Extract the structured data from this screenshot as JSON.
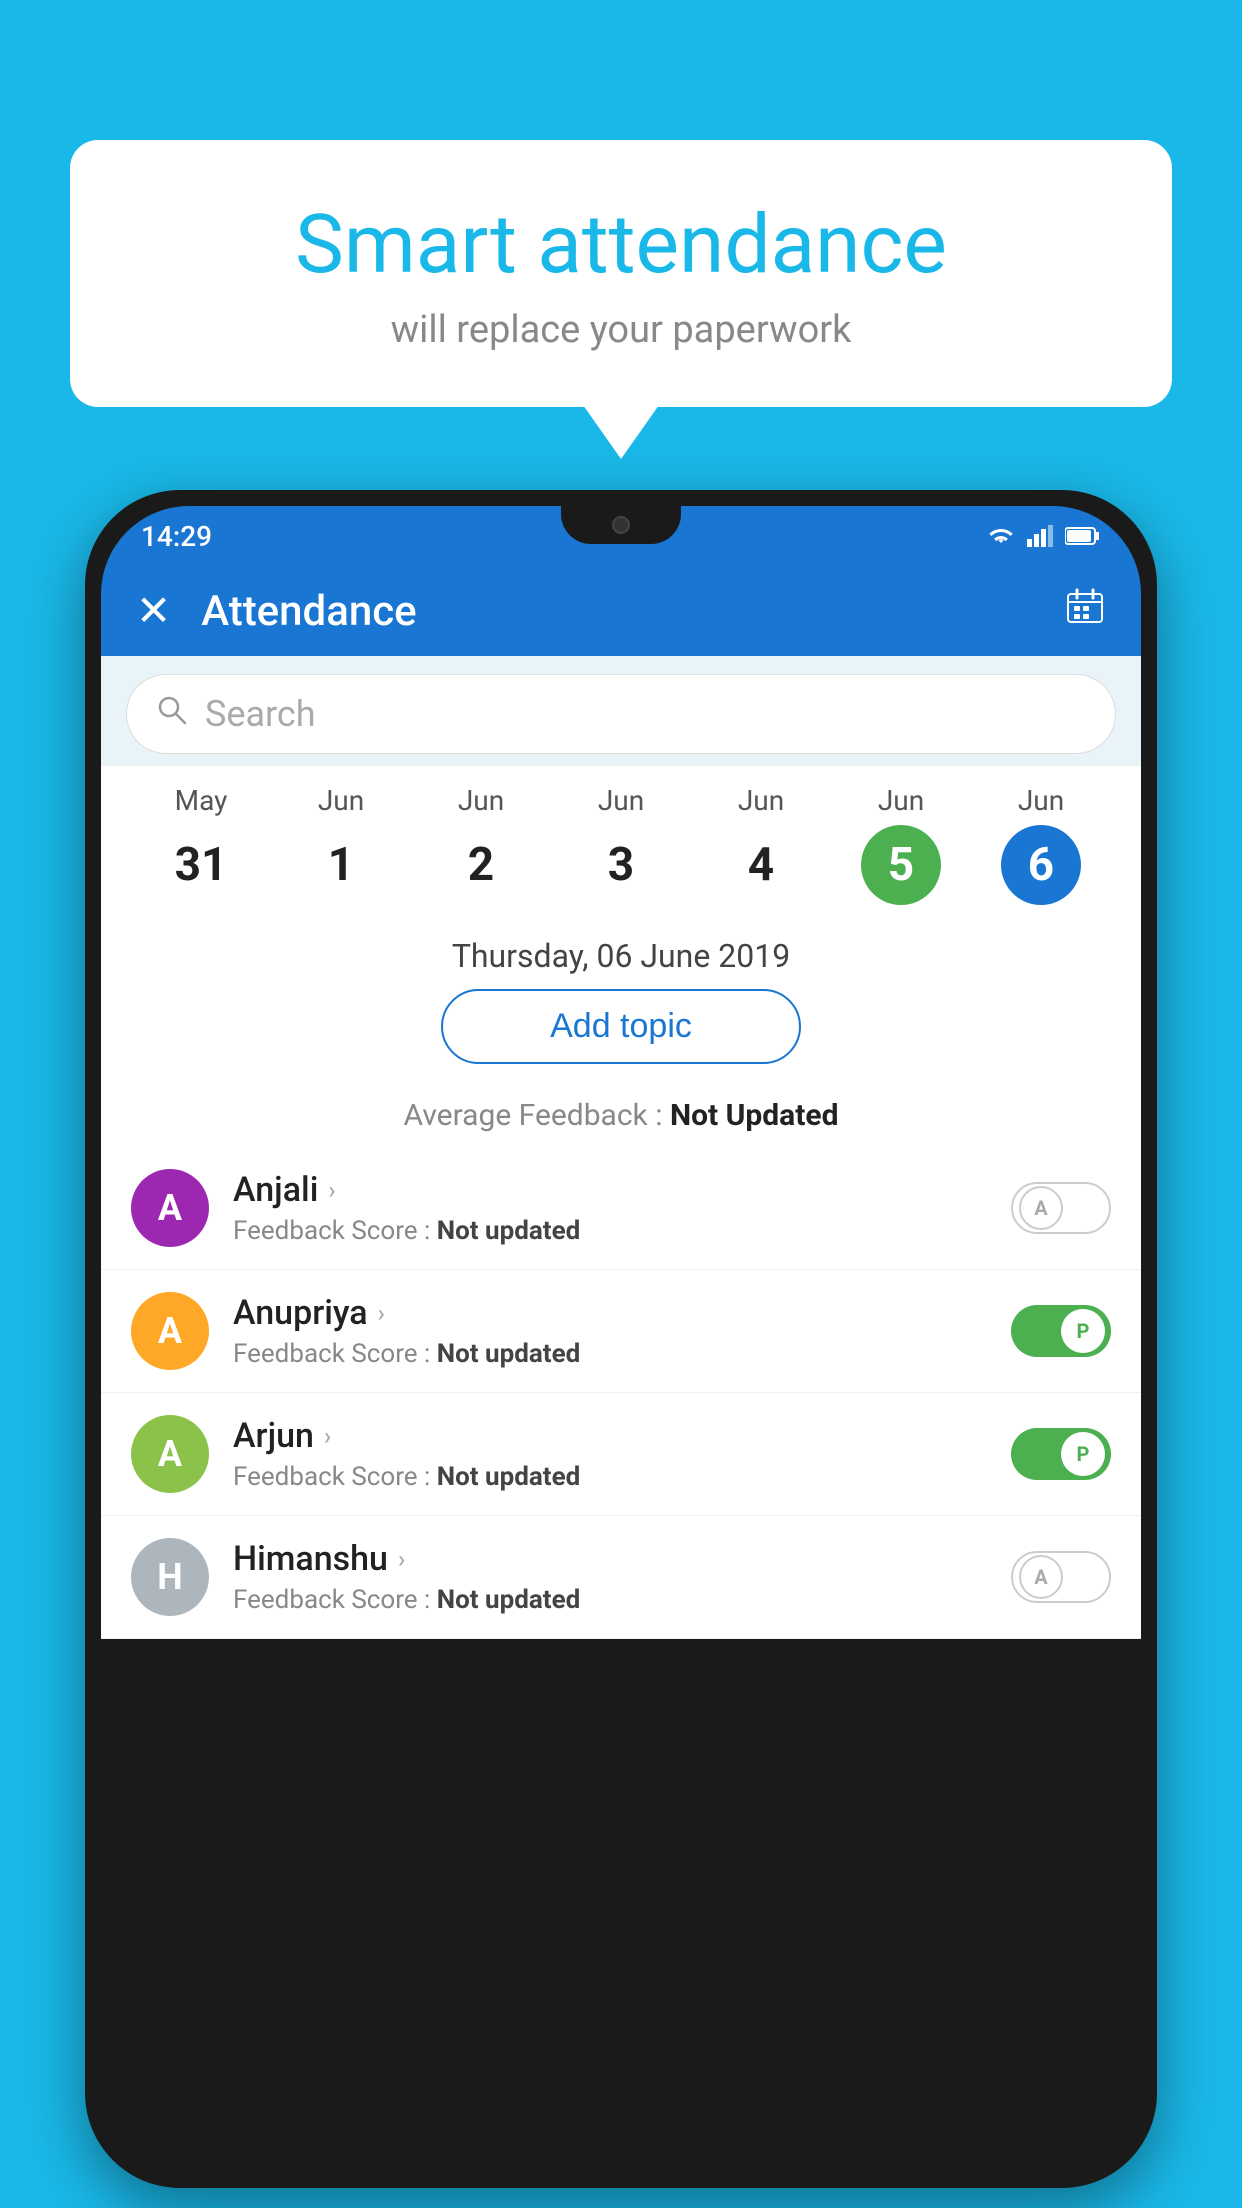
{
  "background_color": "#1ab8e8",
  "bubble": {
    "title": "Smart attendance",
    "subtitle": "will replace your paperwork"
  },
  "phone": {
    "status_bar": {
      "time": "14:29",
      "icons": [
        "wifi",
        "signal",
        "battery"
      ]
    },
    "app_bar": {
      "title": "Attendance",
      "close_icon": "×",
      "calendar_icon": "📅"
    },
    "search": {
      "placeholder": "Search"
    },
    "dates": [
      {
        "month": "May",
        "day": "31",
        "state": "normal"
      },
      {
        "month": "Jun",
        "day": "1",
        "state": "normal"
      },
      {
        "month": "Jun",
        "day": "2",
        "state": "normal"
      },
      {
        "month": "Jun",
        "day": "3",
        "state": "normal"
      },
      {
        "month": "Jun",
        "day": "4",
        "state": "normal"
      },
      {
        "month": "Jun",
        "day": "5",
        "state": "today"
      },
      {
        "month": "Jun",
        "day": "6",
        "state": "selected"
      }
    ],
    "selected_date_label": "Thursday, 06 June 2019",
    "add_topic_label": "Add topic",
    "avg_feedback_label": "Average Feedback :",
    "avg_feedback_value": "Not Updated",
    "students": [
      {
        "name": "Anjali",
        "avatar_letter": "A",
        "avatar_color": "#9c27b0",
        "feedback_label": "Feedback Score :",
        "feedback_value": "Not updated",
        "toggle_state": "off",
        "toggle_label": "A"
      },
      {
        "name": "Anupriya",
        "avatar_letter": "A",
        "avatar_color": "#ffa726",
        "feedback_label": "Feedback Score :",
        "feedback_value": "Not updated",
        "toggle_state": "on",
        "toggle_label": "P"
      },
      {
        "name": "Arjun",
        "avatar_letter": "A",
        "avatar_color": "#8bc34a",
        "feedback_label": "Feedback Score :",
        "feedback_value": "Not updated",
        "toggle_state": "on",
        "toggle_label": "P"
      },
      {
        "name": "Himanshu",
        "avatar_letter": "H",
        "avatar_color": "#adb5bd",
        "feedback_label": "Feedback Score :",
        "feedback_value": "Not updated",
        "toggle_state": "off",
        "toggle_label": "A"
      }
    ]
  }
}
